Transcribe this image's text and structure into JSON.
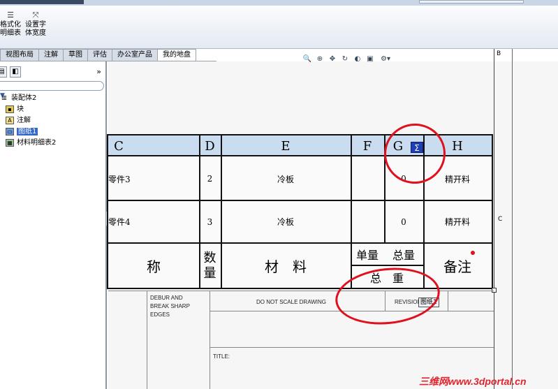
{
  "ribbon": {
    "btn1_label_l1": "格式化",
    "btn1_label_l2": "明细表",
    "btn2_label_l1": "设置字",
    "btn2_label_l2": "体宽度"
  },
  "tabs": [
    "视图布局",
    "注解",
    "草图",
    "评估",
    "办公室产品",
    "我的地盘"
  ],
  "tree": {
    "root": "装配体2",
    "items": [
      "块",
      "注解",
      "图纸1",
      "材料明细表2"
    ]
  },
  "bom": {
    "headers": [
      "C",
      "D",
      "E",
      "F",
      "G",
      "H"
    ],
    "rows": [
      [
        "零件3",
        "2",
        "冷板",
        "",
        "0",
        "精开料"
      ],
      [
        "零件4",
        "3",
        "冷板",
        "",
        "0",
        "精开料"
      ]
    ],
    "footer": {
      "name": "称",
      "qty_l1": "数",
      "qty_l2": "量",
      "material": "材　料",
      "unit_weight": "单量",
      "total_weight": "总量",
      "total": "总　重",
      "remarks": "备注"
    }
  },
  "titleblock": {
    "debur_l1": "DEBUR AND",
    "debur_l2": "BREAK SHARP",
    "debur_l3": "EDGES",
    "noscale": "DO NOT SCALE DRAWING",
    "revision": "REVISION",
    "title": "TITLE:"
  },
  "sheet_marks": {
    "b": "B",
    "c": "C"
  },
  "tooltip": "图纸1",
  "watermark": "三维网www.3dportal.cn",
  "colors": {
    "header_fill": "#c9dcf0",
    "annotation_red": "#e0101e",
    "selection": "#3367c8"
  }
}
